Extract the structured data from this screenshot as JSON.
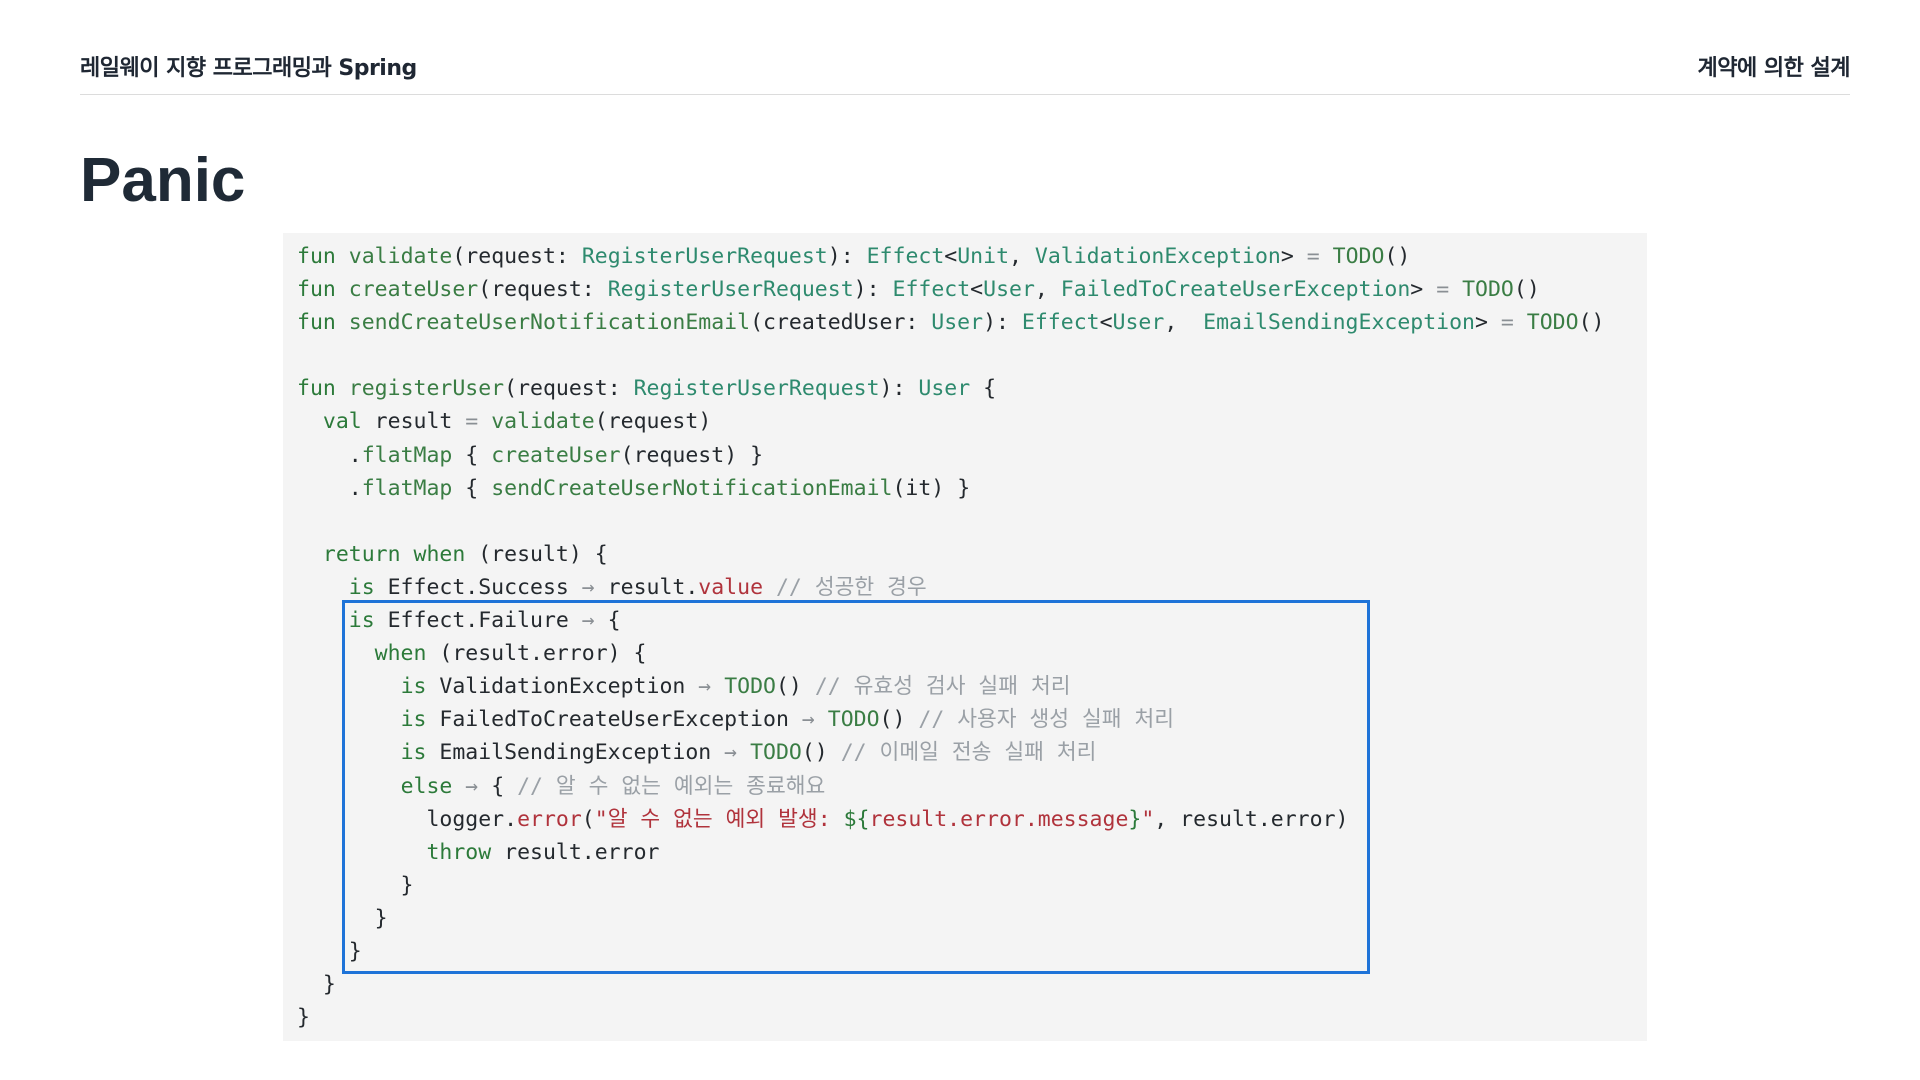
{
  "header": {
    "left_title": "레일웨이 지향 프로그래밍과 Spring",
    "right_title": "계약에 의한 설계"
  },
  "slide": {
    "title": "Panic"
  },
  "colors": {
    "keyword": "#2c7a3a",
    "function": "#3a7d44",
    "type": "#2e8a6e",
    "string": "#b0333c",
    "comment": "#9aa0a6",
    "highlight_border": "#1e73d8",
    "code_background": "#f4f4f4"
  },
  "code": {
    "language": "kotlin",
    "lines": [
      [
        [
          "kw",
          "fun"
        ],
        [
          "p",
          " "
        ],
        [
          "fn",
          "validate"
        ],
        [
          "p",
          "(request: "
        ],
        [
          "ty",
          "RegisterUserRequest"
        ],
        [
          "p",
          "): "
        ],
        [
          "ty",
          "Effect"
        ],
        [
          "p",
          "<"
        ],
        [
          "ty",
          "Unit"
        ],
        [
          "p",
          ", "
        ],
        [
          "ty",
          "ValidationException"
        ],
        [
          "p",
          "> "
        ],
        [
          "op",
          "="
        ],
        [
          "p",
          " "
        ],
        [
          "fn",
          "TODO"
        ],
        [
          "p",
          "()"
        ]
      ],
      [
        [
          "kw",
          "fun"
        ],
        [
          "p",
          " "
        ],
        [
          "fn",
          "createUser"
        ],
        [
          "p",
          "(request: "
        ],
        [
          "ty",
          "RegisterUserRequest"
        ],
        [
          "p",
          "): "
        ],
        [
          "ty",
          "Effect"
        ],
        [
          "p",
          "<"
        ],
        [
          "ty",
          "User"
        ],
        [
          "p",
          ", "
        ],
        [
          "ty",
          "FailedToCreateUserException"
        ],
        [
          "p",
          "> "
        ],
        [
          "op",
          "="
        ],
        [
          "p",
          " "
        ],
        [
          "fn",
          "TODO"
        ],
        [
          "p",
          "()"
        ]
      ],
      [
        [
          "kw",
          "fun"
        ],
        [
          "p",
          " "
        ],
        [
          "fn",
          "sendCreateUserNotificationEmail"
        ],
        [
          "p",
          "(createdUser: "
        ],
        [
          "ty",
          "User"
        ],
        [
          "p",
          "): "
        ],
        [
          "ty",
          "Effect"
        ],
        [
          "p",
          "<"
        ],
        [
          "ty",
          "User"
        ],
        [
          "p",
          ",  "
        ],
        [
          "ty",
          "EmailSendingException"
        ],
        [
          "p",
          "> "
        ],
        [
          "op",
          "="
        ],
        [
          "p",
          " "
        ],
        [
          "fn",
          "TODO"
        ],
        [
          "p",
          "()"
        ]
      ],
      [],
      [
        [
          "kw",
          "fun"
        ],
        [
          "p",
          " "
        ],
        [
          "fn",
          "registerUser"
        ],
        [
          "p",
          "(request: "
        ],
        [
          "ty",
          "RegisterUserRequest"
        ],
        [
          "p",
          "): "
        ],
        [
          "ty",
          "User"
        ],
        [
          "p",
          " {"
        ]
      ],
      [
        [
          "p",
          "  "
        ],
        [
          "kw",
          "val"
        ],
        [
          "p",
          " result "
        ],
        [
          "op",
          "="
        ],
        [
          "p",
          " "
        ],
        [
          "fn",
          "validate"
        ],
        [
          "p",
          "(request)"
        ]
      ],
      [
        [
          "p",
          "    ."
        ],
        [
          "fn",
          "flatMap"
        ],
        [
          "p",
          " { "
        ],
        [
          "fn",
          "createUser"
        ],
        [
          "p",
          "(request) }"
        ]
      ],
      [
        [
          "p",
          "    ."
        ],
        [
          "fn",
          "flatMap"
        ],
        [
          "p",
          " { "
        ],
        [
          "fn",
          "sendCreateUserNotificationEmail"
        ],
        [
          "p",
          "(it) }"
        ]
      ],
      [],
      [
        [
          "p",
          "  "
        ],
        [
          "kw",
          "return"
        ],
        [
          "p",
          " "
        ],
        [
          "kw",
          "when"
        ],
        [
          "p",
          " (result) {"
        ]
      ],
      [
        [
          "p",
          "    "
        ],
        [
          "kw",
          "is"
        ],
        [
          "p",
          " Effect.Success "
        ],
        [
          "op",
          "→"
        ],
        [
          "p",
          " result."
        ],
        [
          "prop",
          "value"
        ],
        [
          "p",
          " "
        ],
        [
          "cmt",
          "// 성공한 경우"
        ]
      ],
      [
        [
          "p",
          "    "
        ],
        [
          "kw",
          "is"
        ],
        [
          "p",
          " Effect.Failure "
        ],
        [
          "op",
          "→"
        ],
        [
          "p",
          " {"
        ]
      ],
      [
        [
          "p",
          "      "
        ],
        [
          "kw",
          "when"
        ],
        [
          "p",
          " (result.error) {"
        ]
      ],
      [
        [
          "p",
          "        "
        ],
        [
          "kw",
          "is"
        ],
        [
          "p",
          " ValidationException "
        ],
        [
          "op",
          "→"
        ],
        [
          "p",
          " "
        ],
        [
          "fn",
          "TODO"
        ],
        [
          "p",
          "() "
        ],
        [
          "cmt",
          "// 유효성 검사 실패 처리"
        ]
      ],
      [
        [
          "p",
          "        "
        ],
        [
          "kw",
          "is"
        ],
        [
          "p",
          " FailedToCreateUserException "
        ],
        [
          "op",
          "→"
        ],
        [
          "p",
          " "
        ],
        [
          "fn",
          "TODO"
        ],
        [
          "p",
          "() "
        ],
        [
          "cmt",
          "// 사용자 생성 실패 처리"
        ]
      ],
      [
        [
          "p",
          "        "
        ],
        [
          "kw",
          "is"
        ],
        [
          "p",
          " EmailSendingException "
        ],
        [
          "op",
          "→"
        ],
        [
          "p",
          " "
        ],
        [
          "fn",
          "TODO"
        ],
        [
          "p",
          "() "
        ],
        [
          "cmt",
          "// 이메일 전송 실패 처리"
        ]
      ],
      [
        [
          "p",
          "        "
        ],
        [
          "kw",
          "else"
        ],
        [
          "p",
          " "
        ],
        [
          "op",
          "→"
        ],
        [
          "p",
          " { "
        ],
        [
          "cmt",
          "// 알 수 없는 예외는 종료해요"
        ]
      ],
      [
        [
          "p",
          "          logger."
        ],
        [
          "prop",
          "error"
        ],
        [
          "p",
          "("
        ],
        [
          "str",
          "\"알 수 없는 예외 발생: "
        ],
        [
          "interp",
          "${"
        ],
        [
          "prop",
          "result.error.message"
        ],
        [
          "interp",
          "}"
        ],
        [
          "str",
          "\""
        ],
        [
          "p",
          ", result.error)"
        ]
      ],
      [
        [
          "p",
          "          "
        ],
        [
          "kw",
          "throw"
        ],
        [
          "p",
          " result.error"
        ]
      ],
      [
        [
          "p",
          "        }"
        ]
      ],
      [
        [
          "p",
          "      }"
        ]
      ],
      [
        [
          "p",
          "    }"
        ]
      ],
      [
        [
          "p",
          "  }"
        ]
      ],
      [
        [
          "p",
          "}"
        ]
      ]
    ]
  }
}
